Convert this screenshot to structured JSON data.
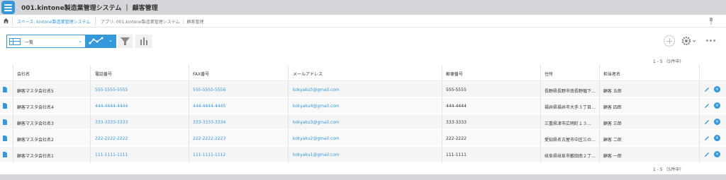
{
  "app": {
    "title": "001.kintone製造業管理システム ｜ 顧客管理"
  },
  "breadcrumb": {
    "space": "スペース: kintone製造業管理システム",
    "app": "アプリ: 001.kintone製造業管理システム ｜ 顧客管理"
  },
  "toolbar": {
    "view_label": "一覧"
  },
  "pagination": {
    "label": "1 - 5 （5件中）"
  },
  "table": {
    "headers": [
      "会社名",
      "電話番号",
      "FAX番号",
      "メールアドレス",
      "郵便番号",
      "住所",
      "担当者名"
    ],
    "rows": [
      {
        "company": "顧客マスタ会社名5",
        "phone": "555-5555-5555",
        "fax": "555-5555-5556",
        "email": "kokyaku5@gmail.com",
        "zip": "555-5555",
        "address": "長野県長野市南長野幅下…",
        "contact": "顧客 五郎"
      },
      {
        "company": "顧客マスタ会社名4",
        "phone": "444-4444-4444",
        "fax": "444-4444-4445",
        "email": "kokyaku4@gmail.com",
        "zip": "444-4444",
        "address": "福井県福井市大手３丁目…",
        "contact": "顧客 四郎"
      },
      {
        "company": "顧客マスタ会社名3",
        "phone": "333-3333-3333",
        "fax": "333-3333-3334",
        "email": "kokyaku3@gmail.com",
        "zip": "333-3333",
        "address": "三重県津市広明町１３…",
        "contact": "顧客 三郎"
      },
      {
        "company": "顧客マスタ会社名2",
        "phone": "222-2222-2222",
        "fax": "222-2222-2223",
        "email": "kokyaku2@gmail.com",
        "zip": "222-2222",
        "address": "愛知県名古屋市中区三の…",
        "contact": "顧客 二郎"
      },
      {
        "company": "顧客マスタ会社名1",
        "phone": "111-1111-1111",
        "fax": "111-1111-1112",
        "email": "kokyaku1@gmail.com",
        "zip": "111-1111",
        "address": "岐阜県岐阜市薮田南２丁…",
        "contact": "顧客 一郎"
      }
    ]
  },
  "colors": {
    "accent": "#3498db",
    "titlebar": "#d4d6d9"
  },
  "icons": [
    "menu-icon",
    "home-icon",
    "pin-icon",
    "grid-icon",
    "chevron-down-icon",
    "line-chart-icon",
    "filter-icon",
    "bar-chart-icon",
    "add-icon",
    "gear-icon",
    "more-icon",
    "document-icon",
    "edit-icon",
    "delete-icon"
  ]
}
